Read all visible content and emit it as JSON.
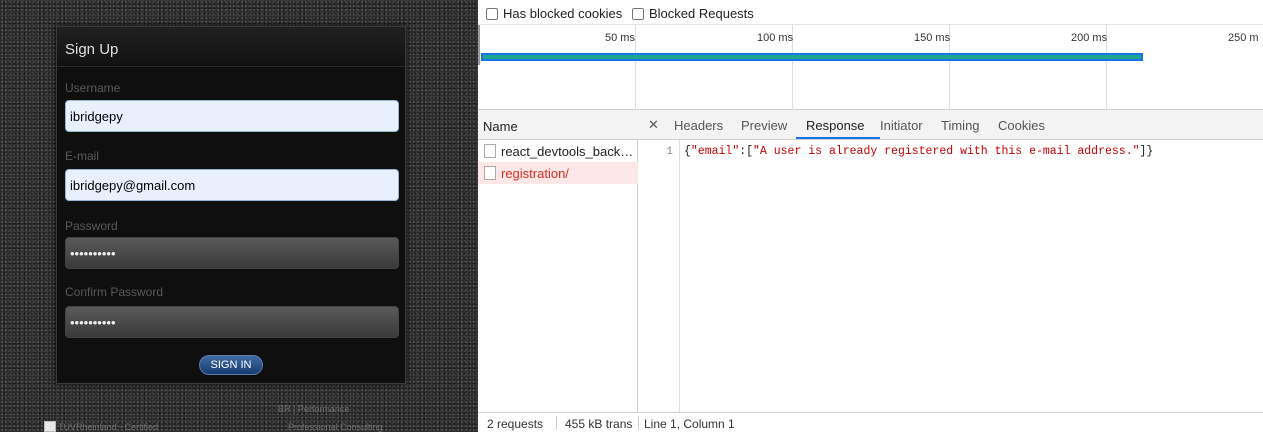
{
  "signup": {
    "title": "Sign Up",
    "username_label": "Username",
    "username_value": "ibridgepy",
    "email_label": "E-mail",
    "email_value": "ibridgepy@gmail.com",
    "password_label": "Password",
    "password_masked": "••••••••••",
    "confirm_label": "Confirm Password",
    "confirm_masked": "••••••••••",
    "submit_label": "SIGN IN"
  },
  "footer": {
    "cert_alt": "TUVRheinland - Certified",
    "line1": "BR | Performance",
    "line2": "Professional Consulting"
  },
  "devtools": {
    "filters": {
      "blocked_cookies": "Has blocked cookies",
      "blocked_requests": "Blocked Requests"
    },
    "timeline_ticks": [
      "50 ms",
      "100 ms",
      "150 ms",
      "200 ms",
      "250 m"
    ],
    "name_header": "Name",
    "requests": [
      {
        "name": "react_devtools_back…"
      },
      {
        "name": "registration/"
      }
    ],
    "tabs": [
      "Headers",
      "Preview",
      "Response",
      "Initiator",
      "Timing",
      "Cookies"
    ],
    "active_tab": "Response",
    "response": {
      "line_number": "1",
      "key": "\"email\"",
      "message": "\"A user is already registered with this e-mail address.\""
    },
    "status": {
      "requests": "2 requests",
      "transferred": "455 kB trans",
      "position": "Line 1, Column 1"
    },
    "colors": {
      "accent": "#1a73e8",
      "error": "#d93025",
      "string": "#c80000",
      "waterfall": "#1fa890"
    }
  }
}
